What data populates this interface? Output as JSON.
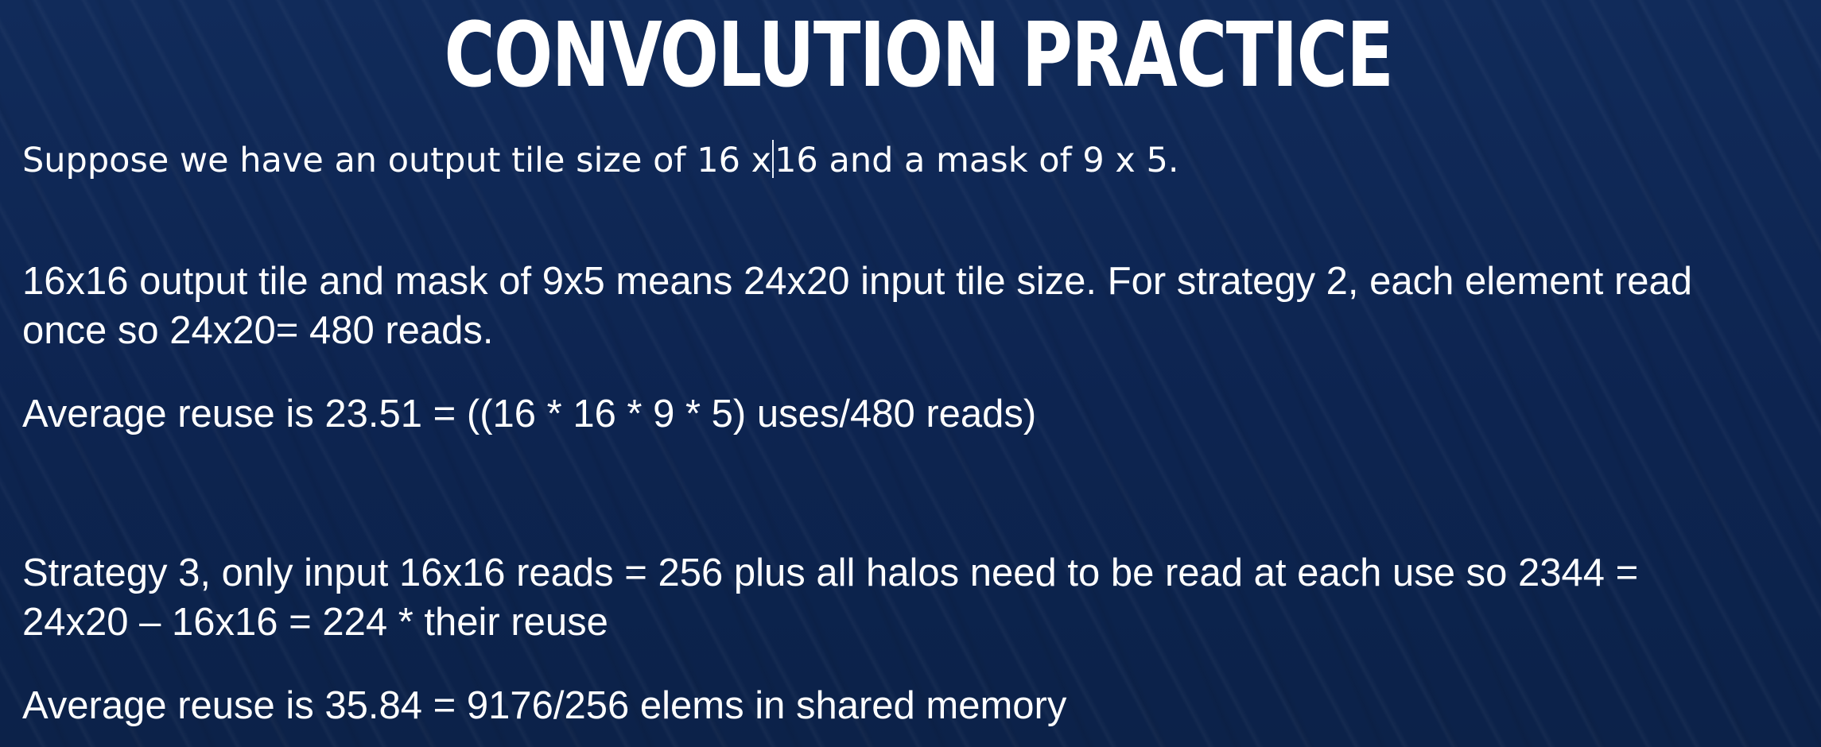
{
  "slide": {
    "title": "CONVOLUTION PRACTICE",
    "intro_part1": "Suppose we have an output tile size of 16 x",
    "intro_part2": "16 and a mask of 9 x 5.",
    "paragraph1_line1": "16x16 output tile and mask of 9x5 means 24x20 input tile size. For strategy 2, each element read",
    "paragraph1_line2": "once so 24x20= 480 reads.",
    "paragraph2": "Average reuse is 23.51 = ((16 * 16 * 9 * 5) uses/480 reads)",
    "paragraph3_line1": "Strategy 3, only input 16x16 reads = 256 plus all halos need to be read at each use so 2344 =",
    "paragraph3_line2": "24x20 – 16x16 = 224 * their reuse",
    "paragraph4": "Average reuse is 35.84 = 9176/256 elems in shared memory"
  },
  "colors": {
    "background": "#0f2752",
    "text": "#ffffff"
  }
}
